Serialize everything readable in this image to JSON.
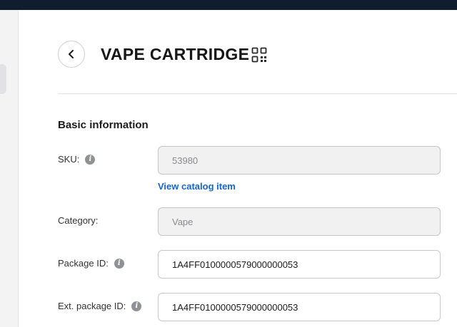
{
  "header": {
    "title": "VAPE CARTRIDGE",
    "back_icon": "chevron-left-icon",
    "qr_icon": "qr-code-icon"
  },
  "basic_info": {
    "section_title": "Basic information",
    "sku": {
      "label": "SKU:",
      "value": "53980",
      "disabled": true
    },
    "view_catalog_link": "View catalog item",
    "category": {
      "label": "Category:",
      "value": "Vape",
      "disabled": true
    },
    "package_id": {
      "label": "Package ID:",
      "value": "1A4FF0100000579000000053"
    },
    "ext_package_id": {
      "label": "Ext. package ID:",
      "value": "1A4FF0100000579000000053"
    }
  },
  "colors": {
    "topbar": "#0f1d2e",
    "link": "#1467c8",
    "info_icon": "#8f9196"
  }
}
